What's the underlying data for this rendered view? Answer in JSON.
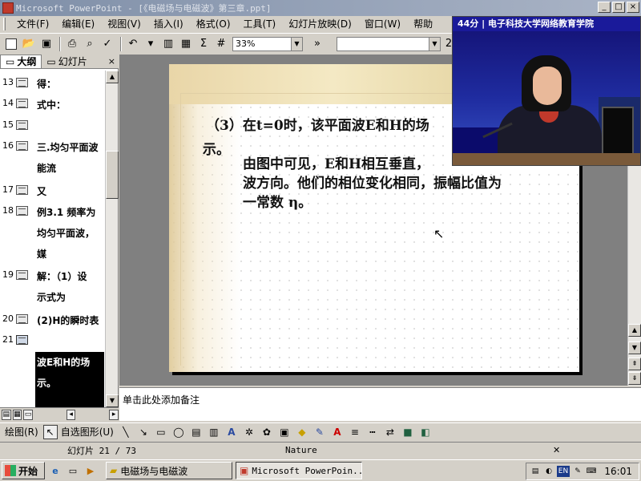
{
  "window": {
    "title": "Microsoft PowerPoint - [《电磁场与电磁波》第三章.ppt]",
    "controls": [
      "_",
      "□",
      "×"
    ]
  },
  "menu": [
    "文件(F)",
    "编辑(E)",
    "视图(V)",
    "插入(I)",
    "格式(O)",
    "工具(T)",
    "幻灯片放映(D)",
    "窗口(W)",
    "帮助"
  ],
  "toolbar": {
    "zoom": "33%",
    "font_size": "2"
  },
  "outline": {
    "tabs": [
      "大纲",
      "幻灯片"
    ],
    "close": "×",
    "rows": [
      {
        "num": "13",
        "lines": [
          "得："
        ]
      },
      {
        "num": "14",
        "lines": [
          "式中："
        ]
      },
      {
        "num": "15",
        "lines": [
          ""
        ]
      },
      {
        "num": "16",
        "lines": [
          "三.均匀平面波",
          "能流"
        ]
      },
      {
        "num": "17",
        "lines": [
          "又"
        ]
      },
      {
        "num": "18",
        "lines": [
          "例3.1 频率为",
          "均匀平面波，",
          "媒"
        ]
      },
      {
        "num": "19",
        "lines": [
          "解：（1）设",
          "示式为"
        ]
      },
      {
        "num": "20",
        "lines": [
          "(2)H的瞬时表"
        ]
      },
      {
        "num": "21",
        "lines": [
          "（3）在t=0时",
          "波E和H的场",
          "示。"
        ],
        "selected": true
      }
    ]
  },
  "slide": {
    "line1": "（3）在t=0时，该平面波E和H的场",
    "line2": "示。",
    "para": [
      "由图中可见，E和H相互垂直，",
      "波方向。他们的相位变化相同，振幅比值为",
      "一常数 η。"
    ]
  },
  "notes_placeholder": "单击此处添加备注",
  "drawing_toolbar": {
    "draw": "绘图(R)",
    "autoshapes": "自选图形(U)"
  },
  "status": {
    "slide": "幻灯片 21 / 73",
    "design": "Nature"
  },
  "taskbar": {
    "start": "开始",
    "tasks": [
      "电磁场与电磁波",
      "Microsoft PowerPoin..."
    ],
    "tray_lang": "EN",
    "clock": "16:01"
  },
  "video": {
    "banner": "44分 | 电子科技大学网络教育学院"
  }
}
